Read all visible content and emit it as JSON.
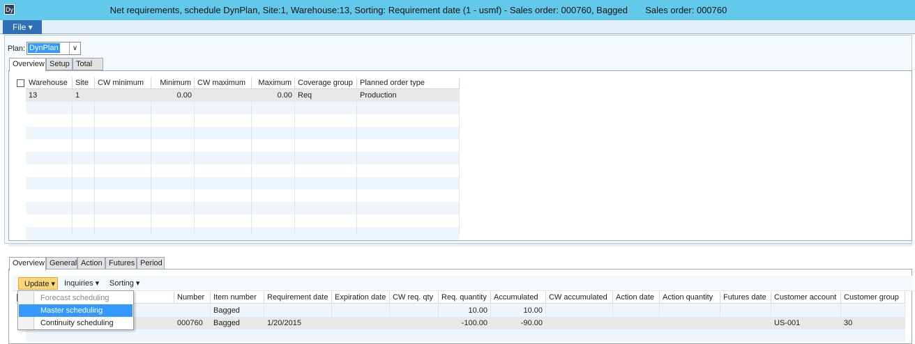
{
  "window": {
    "title": "Net requirements, schedule DynPlan, Site:1, Warehouse:13, Sorting: Requirement date (1 - usmf) - Sales order: 000760, Bagged       Sales order: 000760",
    "icon": "app-icon"
  },
  "menu": {
    "file_label": "File ▾"
  },
  "plan": {
    "label": "Plan:",
    "value": "DynPlan"
  },
  "top_tabs": [
    "Overview",
    "Setup",
    "Total"
  ],
  "top_grid": {
    "columns": [
      "Warehouse",
      "Site",
      "CW minimum",
      "Minimum",
      "CW maximum",
      "Maximum",
      "Coverage group",
      "Planned order type"
    ],
    "rows": [
      [
        "13",
        "1",
        "",
        "0.00",
        "",
        "0.00",
        "Req",
        "Production"
      ]
    ]
  },
  "bottom_tabs": [
    "Overview",
    "General",
    "Action",
    "Futures",
    "Period"
  ],
  "toolbar": {
    "update": "Update",
    "inquiries": "Inquiries",
    "sorting": "Sorting"
  },
  "update_menu": {
    "items": [
      "Forecast scheduling",
      "Master scheduling",
      "Continuity scheduling"
    ],
    "highlighted": "Master scheduling"
  },
  "bottom_grid": {
    "columns": [
      "Number",
      "Item number",
      "Requirement date",
      "Expiration date",
      "CW req. qty",
      "Req. quantity",
      "Accumulated",
      "CW accumulated",
      "Action date",
      "Action quantity",
      "Futures date",
      "Customer account",
      "Customer group"
    ],
    "rows": [
      [
        "",
        "Bagged",
        "",
        "",
        "",
        "10.00",
        "10.00",
        "",
        "",
        "",
        "",
        "",
        ""
      ],
      [
        "000760",
        "Bagged",
        "1/20/2015",
        "",
        "",
        "-100.00",
        "-90.00",
        "",
        "",
        "",
        "",
        "US-001",
        "30"
      ]
    ]
  },
  "colors": {
    "titlebar": "#62c9ea",
    "file": "#2e6fb8",
    "highlight": "#3399ff",
    "update": "#fbd77a"
  }
}
